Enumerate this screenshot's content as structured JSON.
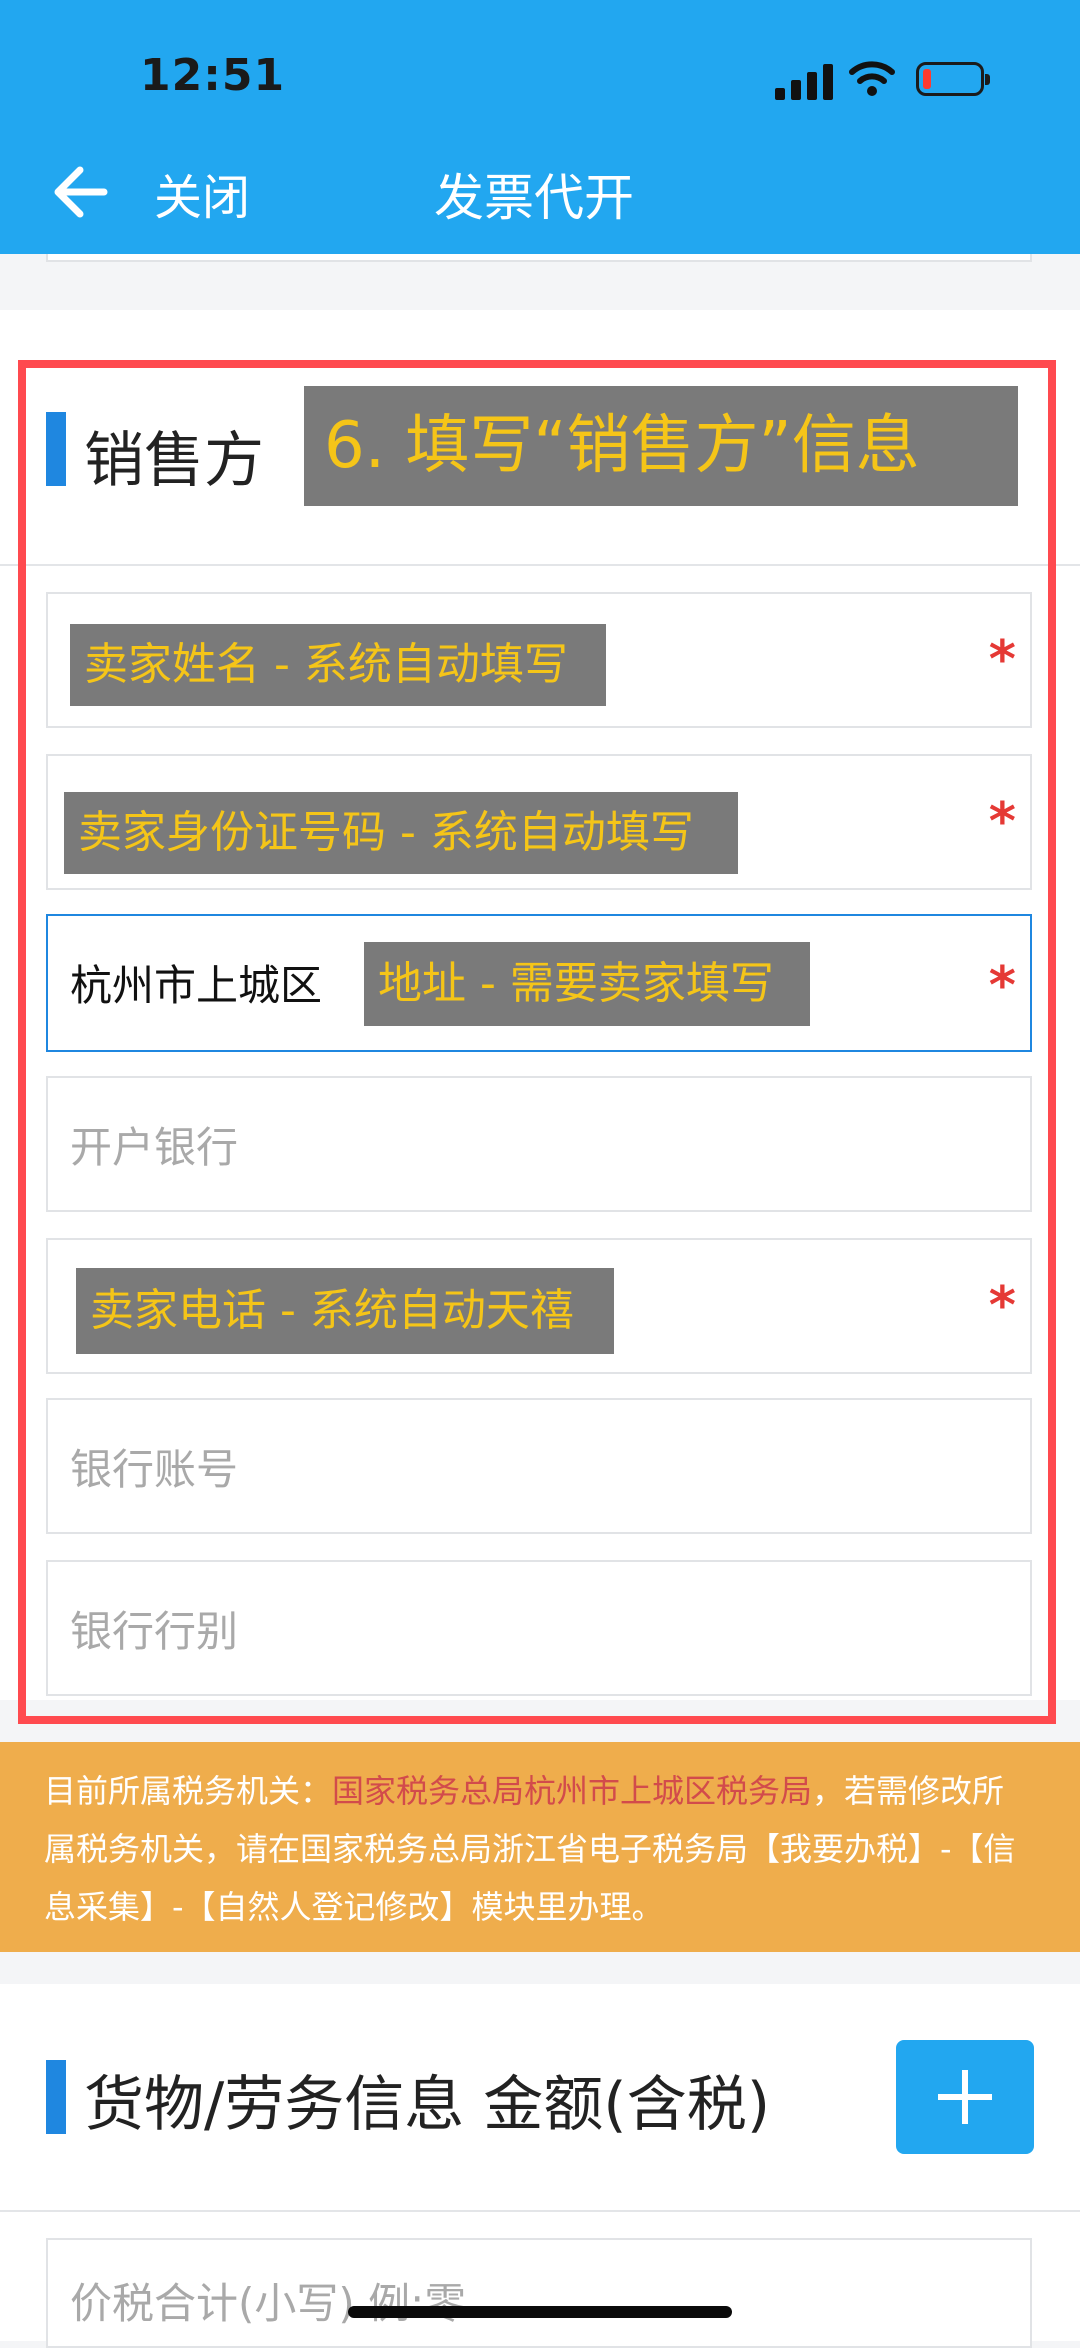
{
  "status_bar": {
    "time": "12:51"
  },
  "nav": {
    "back_label": "关闭",
    "title": "发票代开"
  },
  "seller": {
    "section_title": "销售方",
    "annotation": "6. 填写“销售方”信息",
    "fields": {
      "name": {
        "annotation": "卖家姓名 - 系统自动填写",
        "required": "*"
      },
      "id_number": {
        "annotation": "卖家身份证号码 - 系统自动填写",
        "required": "*"
      },
      "address": {
        "value": "杭州市上城区",
        "annotation": "地址 - 需要卖家填写",
        "required": "*"
      },
      "bank": {
        "placeholder": "开户银行"
      },
      "phone": {
        "annotation": "卖家电话 - 系统自动天禧",
        "required": "*"
      },
      "bank_account": {
        "placeholder": "银行账号"
      },
      "bank_type": {
        "placeholder": "银行行别"
      }
    }
  },
  "notice": {
    "prefix": "目前所属税务机关：",
    "authority": "国家税务总局杭州市上城区税务局",
    "suffix": "，若需修改所属税务机关，请在国家税务总局浙江省电子税务局【我要办税】-【信息采集】-【自然人登记修改】模块里办理。"
  },
  "goods": {
    "section_title": "货物/劳务信息 金额(含税)",
    "add_button": "+",
    "total_placeholder": "价税合计(小写) 例:零"
  },
  "colors": {
    "header": "#22a7f0",
    "accent_bar": "#1f87e0",
    "notice_bg": "#efad4c",
    "annotation_text": "#f5c518",
    "highlight_box": "#ff4a4f"
  }
}
